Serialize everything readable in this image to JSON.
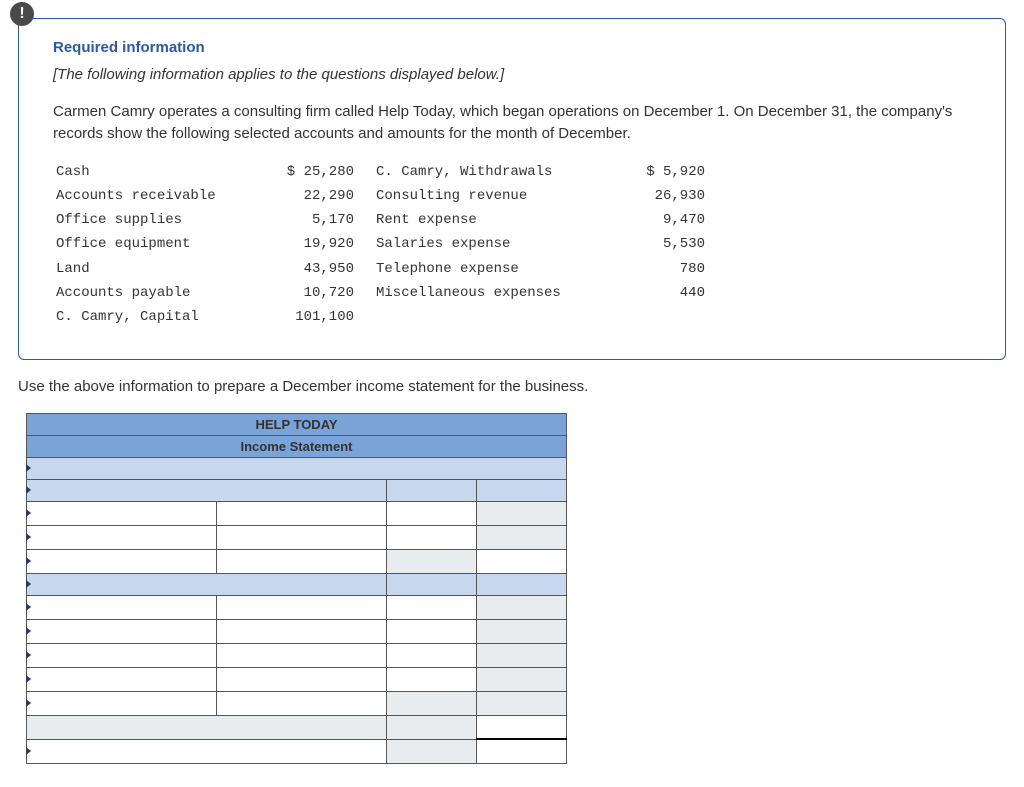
{
  "badge_symbol": "!",
  "required_title": "Required information",
  "italic_note": "[The following information applies to the questions displayed below.]",
  "body_text": "Carmen Camry operates a consulting firm called Help Today, which began operations on December 1. On December 31, the company's records show the following selected accounts and amounts for the month of December.",
  "accounts_left": [
    {
      "label": "Cash",
      "amount": "$ 25,280"
    },
    {
      "label": "Accounts receivable",
      "amount": "22,290"
    },
    {
      "label": "Office supplies",
      "amount": "5,170"
    },
    {
      "label": "Office equipment",
      "amount": "19,920"
    },
    {
      "label": "Land",
      "amount": "43,950"
    },
    {
      "label": "Accounts payable",
      "amount": "10,720"
    },
    {
      "label": "C. Camry, Capital",
      "amount": "101,100"
    }
  ],
  "accounts_right": [
    {
      "label": "C. Camry, Withdrawals",
      "amount": "$ 5,920"
    },
    {
      "label": "Consulting revenue",
      "amount": "26,930"
    },
    {
      "label": "Rent expense",
      "amount": "9,470"
    },
    {
      "label": "Salaries expense",
      "amount": "5,530"
    },
    {
      "label": "Telephone expense",
      "amount": "780"
    },
    {
      "label": "Miscellaneous expenses",
      "amount": "440"
    },
    {
      "label": "",
      "amount": ""
    }
  ],
  "instruction": "Use the above information to prepare a December income statement for the business.",
  "worksheet": {
    "header": "HELP TODAY",
    "subheader": "Income Statement"
  }
}
